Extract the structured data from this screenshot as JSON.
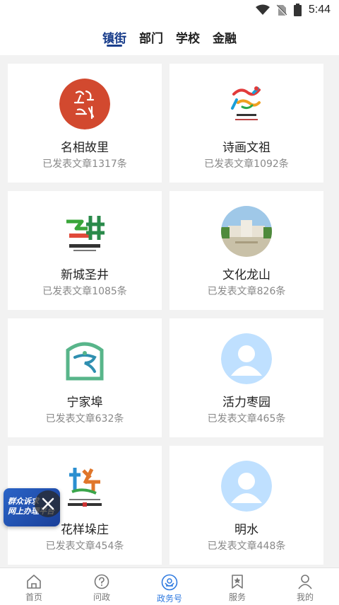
{
  "status": {
    "time": "5:44"
  },
  "tabs": [
    "镇街",
    "部门",
    "学校",
    "金融"
  ],
  "cards": [
    {
      "name": "名相故里",
      "count": "已发表文章1317条",
      "logo": "red-calligraphy-logo"
    },
    {
      "name": "诗画文祖",
      "count": "已发表文章1092条",
      "logo": "dancing-figure-logo"
    },
    {
      "name": "新城圣井",
      "count": "已发表文章1085条",
      "logo": "green-red-character-logo"
    },
    {
      "name": "文化龙山",
      "count": "已发表文章826条",
      "logo": "building-photo"
    },
    {
      "name": "宁家埠",
      "count": "已发表文章632条",
      "logo": "green-house-logo"
    },
    {
      "name": "活力枣园",
      "count": "已发表文章465条",
      "logo": "default-avatar"
    },
    {
      "name": "花样垛庄",
      "count": "已发表文章454条",
      "logo": "colorful-character-logo"
    },
    {
      "name": "明水",
      "count": "已发表文章448条",
      "logo": "default-avatar"
    }
  ],
  "floater": {
    "line1": "群众诉求",
    "line2": "网上办理平台"
  },
  "nav": [
    {
      "label": "首页",
      "icon": "home-icon"
    },
    {
      "label": "问政",
      "icon": "question-icon"
    },
    {
      "label": "政务号",
      "icon": "emblem-icon"
    },
    {
      "label": "服务",
      "icon": "star-bookmark-icon"
    },
    {
      "label": "我的",
      "icon": "user-icon"
    }
  ],
  "colors": {
    "active_tab": "#1b3f8c",
    "active_nav": "#2f7ae0",
    "avatar": "#bfe0ff"
  }
}
